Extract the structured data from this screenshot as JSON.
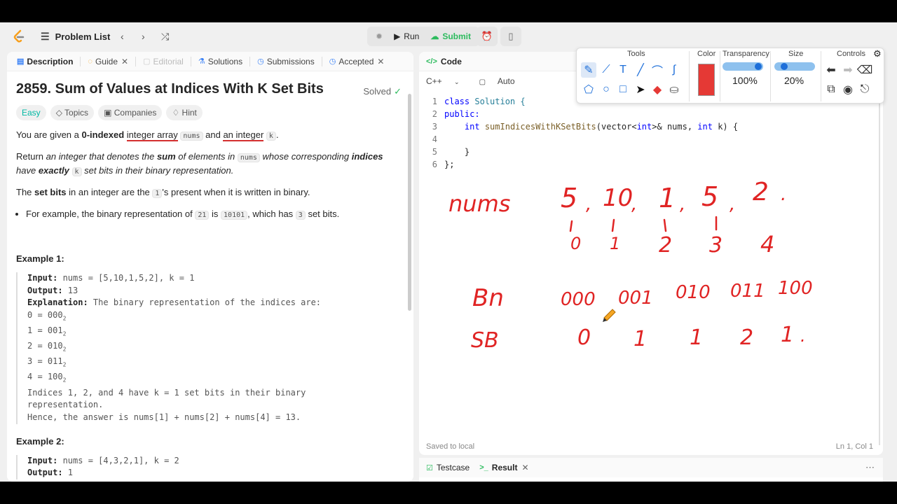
{
  "nav": {
    "problem_list": "Problem List",
    "run": "Run",
    "submit": "Submit"
  },
  "tabs": {
    "description": "Description",
    "guide": "Guide",
    "editorial": "Editorial",
    "solutions": "Solutions",
    "submissions": "Submissions",
    "accepted": "Accepted"
  },
  "problem": {
    "title": "2859. Sum of Values at Indices With K Set Bits",
    "status": "Solved",
    "chips": [
      "Easy",
      "Topics",
      "Companies",
      "Hint"
    ],
    "para1": {
      "a": "You are given a ",
      "b": "0-indexed",
      "c": "integer array",
      "d": "nums",
      "e": "and",
      "f": "an integer",
      "g": "k",
      "h": "."
    },
    "para2": {
      "a": "Return ",
      "b": "an integer that denotes the ",
      "c": "sum",
      "d": " of elements in ",
      "e": "nums",
      "f": " whose corresponding ",
      "g": "indices",
      "h": "have ",
      "i": "exactly",
      "j": "k",
      "k": " set bits in their binary representation."
    },
    "para3": {
      "a": "The ",
      "b": "set bits",
      "c": " in an integer are the ",
      "d": "1",
      "e": "'s present when it is written in binary."
    },
    "bullet": {
      "a": "For example, the binary representation of ",
      "b": "21",
      "c": " is ",
      "d": "10101",
      "e": ", which has ",
      "f": "3",
      "g": " set bits."
    },
    "example1_title": "Example 1:",
    "example1": {
      "input_label": "Input:",
      "input": " nums = [5,10,1,5,2], k = 1",
      "output_label": "Output:",
      "output": " 13",
      "expl_label": "Explanation:",
      "expl": " The binary representation of the indices are:",
      "rows": [
        {
          "lhs": "0 = 000",
          "sub": "2"
        },
        {
          "lhs": "1 = 001",
          "sub": "2"
        },
        {
          "lhs": "2 = 010",
          "sub": "2"
        },
        {
          "lhs": "3 = 011",
          "sub": "2"
        },
        {
          "lhs": "4 = 100",
          "sub": "2"
        }
      ],
      "line_a": "Indices 1, 2, and 4 have k = 1 set bits in their binary",
      "line_b": "representation.",
      "line_c": "Hence, the answer is nums[1] + nums[2] + nums[4] = 13."
    },
    "example2_title": "Example 2:",
    "example2": {
      "input_label": "Input:",
      "input": " nums = [4,3,2,1], k = 2",
      "output_label": "Output:",
      "output": " 1"
    }
  },
  "editor": {
    "header": "Code",
    "lang": "C++",
    "mode": "Auto",
    "lines": [
      "1",
      "2",
      "3",
      "4",
      "5",
      "6"
    ],
    "code": {
      "l1a": "class",
      "l1b": " Solution {",
      "l2": "public:",
      "l3a": "    ",
      "l3b": "int",
      "l3c": " ",
      "l3d": "sumIndicesWithKSetBits",
      "l3e": "(vector<",
      "l3f": "int",
      "l3g": ">& nums, ",
      "l3h": "int",
      "l3i": " k) {",
      "l4": "",
      "l5": "    }",
      "l6": "};"
    },
    "status_left": "Saved to local",
    "status_right": "Ln 1, Col 1"
  },
  "bottom": {
    "testcase": "Testcase",
    "result": "Result"
  },
  "toolbar": {
    "tools": "Tools",
    "color": "Color",
    "transparency": "Transparency",
    "size": "Size",
    "controls": "Controls",
    "transparency_value": "100%",
    "size_value": "20%",
    "selected_color": "#e53935"
  },
  "handwriting": {
    "label_nums": "nums",
    "label_bn": "Bn",
    "label_sb": "SB",
    "values": [
      "5",
      "10",
      "1",
      "5",
      "2"
    ],
    "indices": [
      "0",
      "1",
      "2",
      "3",
      "4"
    ],
    "binary": [
      "000",
      "001",
      "010",
      "011",
      "100"
    ],
    "setbits": [
      "0",
      "1",
      "1",
      "2",
      "1"
    ]
  }
}
